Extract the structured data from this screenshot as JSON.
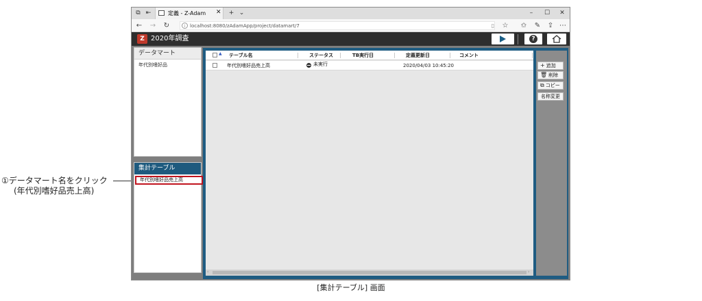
{
  "browser": {
    "tab_title": "定義 - Z-Adam",
    "url": "localhost:8080/zAdamApp/project/datamart/7"
  },
  "app": {
    "project_title": "2020年調査",
    "logo_glyph": "Z"
  },
  "left_panel": {
    "datamart_header": "データマート",
    "datamart_items": [
      "年代別嗜好品"
    ],
    "agg_header": "集計テーブル",
    "agg_items": [
      "年代別嗜好品売上高"
    ]
  },
  "grid": {
    "columns": [
      "テーブル名",
      "ステータス",
      "TB実行日",
      "定義更新日",
      "コメント"
    ],
    "rows": [
      {
        "name": "年代別嗜好品売上高",
        "status": "未実行",
        "tb_exec": "",
        "updated": "2020/04/03 10:45:20",
        "comment": ""
      }
    ]
  },
  "actions": {
    "add": "追加",
    "delete": "削除",
    "copy": "コピー",
    "rename": "名称変更"
  },
  "annotation": {
    "main": "①データマート名をクリック",
    "sub": "(年代別嗜好品売上高)"
  },
  "caption": "[集計テーブル] 画面",
  "colors": {
    "accent_frame": "#1f5c82",
    "header_bg": "#2e2e2e",
    "highlight": "#c0141e",
    "logo": "#c0392b"
  },
  "icons": [
    "tab-manager-icon",
    "page-icon",
    "refresh-icon",
    "favorites-icon",
    "share-icon",
    "more-icon",
    "play-icon",
    "help-icon",
    "home-icon",
    "plus-icon",
    "trash-icon",
    "copy-icon"
  ]
}
